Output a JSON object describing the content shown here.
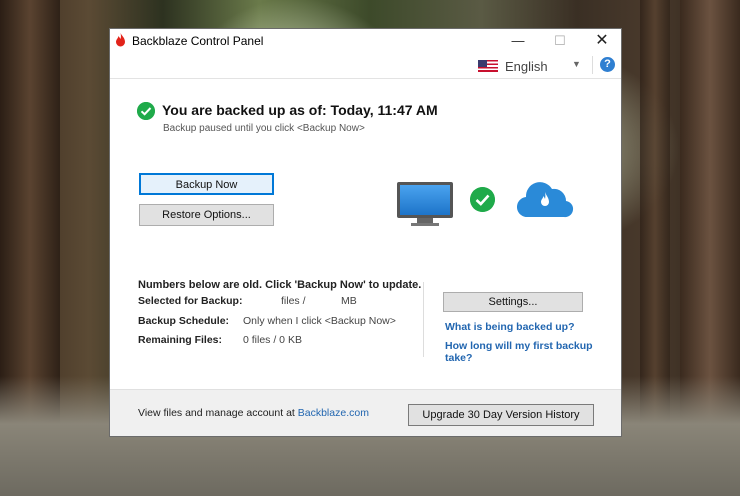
{
  "window": {
    "title": "Backblaze Control Panel",
    "minimize": "—",
    "maximize": "☐",
    "close": "✕"
  },
  "language": {
    "selected": "English",
    "caret": "▼",
    "help": "?"
  },
  "status": {
    "title": "You are backed up as of: Today, 11:47 AM",
    "subtitle": "Backup paused until you click <Backup Now>"
  },
  "buttons": {
    "backup_now": "Backup Now",
    "restore_options": "Restore Options...",
    "settings": "Settings...",
    "upgrade": "Upgrade 30 Day Version History"
  },
  "info": {
    "notice": "Numbers below are old.  Click 'Backup Now' to update.",
    "selected_label": "Selected for Backup:",
    "selected_files": "files /",
    "selected_mb": "MB",
    "schedule_label": "Backup Schedule:",
    "schedule_value": "Only when I click <Backup Now>",
    "remaining_label": "Remaining Files:",
    "remaining_value": "0 files / 0 KB"
  },
  "links": {
    "what_backed_up": "What is being backed up?",
    "first_backup": "How long will my first backup take?"
  },
  "footer": {
    "text": "View files and manage account at ",
    "link": "Backblaze.com"
  },
  "colors": {
    "accent": "#0078d7",
    "success": "#1faa4a",
    "link": "#2266b0"
  },
  "icons": [
    "backblaze-flame-icon",
    "us-flag-icon",
    "help-icon",
    "check-icon",
    "monitor-icon",
    "cloud-icon"
  ]
}
